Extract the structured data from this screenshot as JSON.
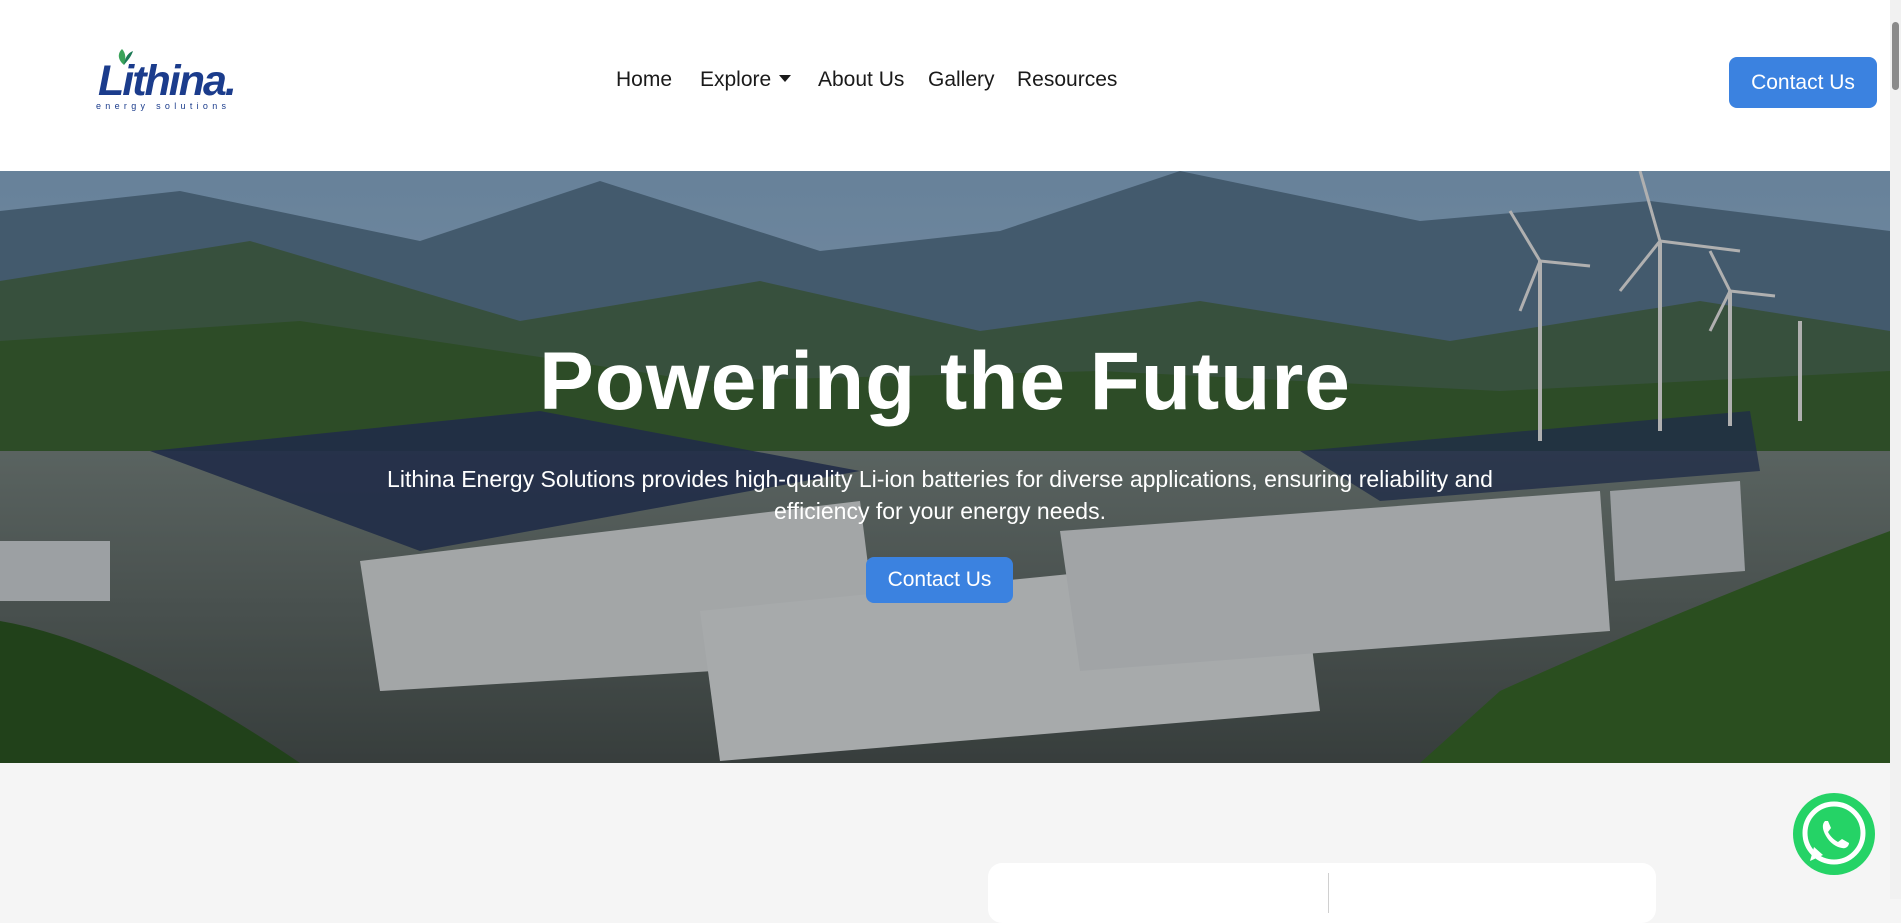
{
  "logo": {
    "word": "Lithina.",
    "tagline": "energy solutions"
  },
  "nav": {
    "home": "Home",
    "explore": "Explore",
    "about": "About Us",
    "gallery": "Gallery",
    "resources": "Resources"
  },
  "header": {
    "contact_label": "Contact Us"
  },
  "hero": {
    "title": "Powering the Future",
    "description": "Lithina Energy Solutions provides high-quality Li-ion batteries for diverse applications, ensuring reliability and efficiency for your energy needs.",
    "cta_label": "Contact Us"
  },
  "colors": {
    "accent": "#3b82e0",
    "brand": "#1b3c8c",
    "whatsapp": "#25d366"
  },
  "icons": {
    "explore_caret": "caret-down-icon",
    "whatsapp": "whatsapp-icon"
  }
}
